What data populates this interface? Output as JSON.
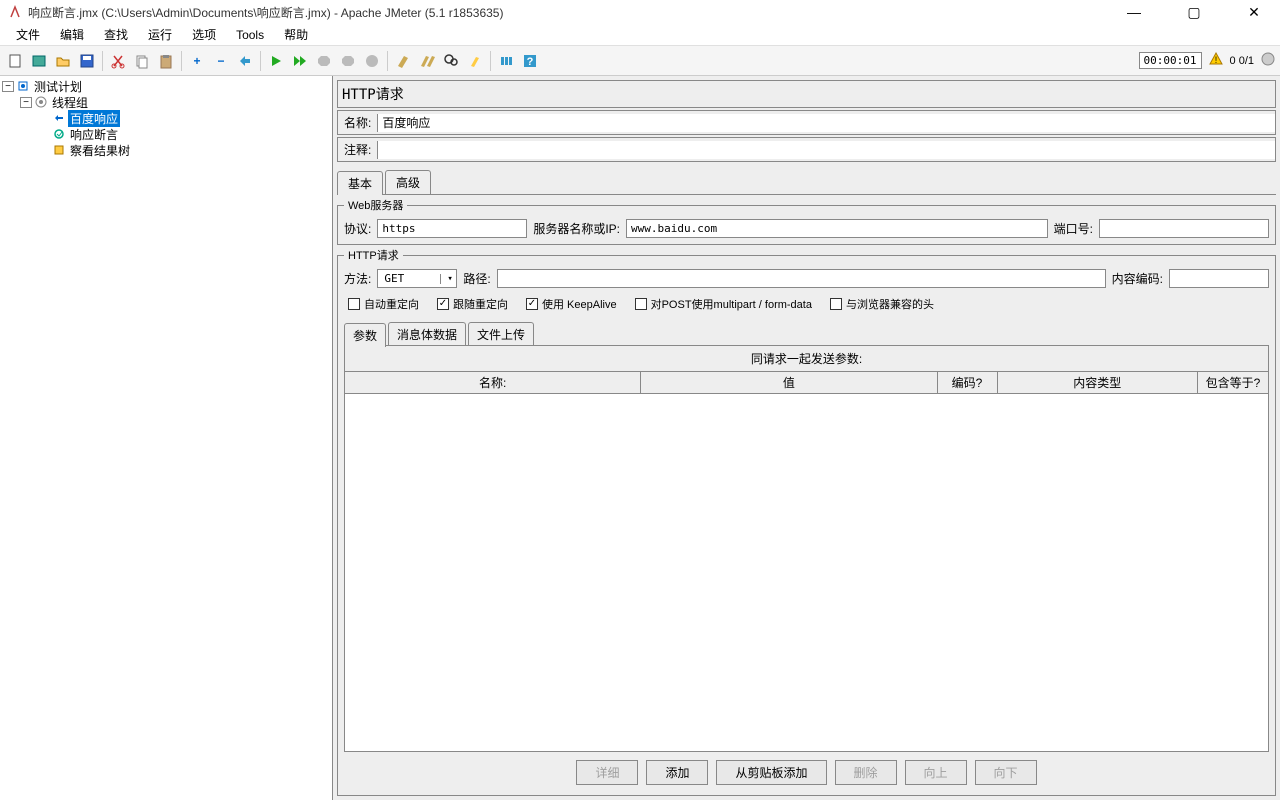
{
  "window": {
    "title": "响应断言.jmx (C:\\Users\\Admin\\Documents\\响应断言.jmx) - Apache JMeter (5.1 r1853635)"
  },
  "menu": {
    "file": "文件",
    "edit": "编辑",
    "search": "查找",
    "run": "运行",
    "options": "选项",
    "tools": "Tools",
    "help": "帮助"
  },
  "toolbar": {
    "timer": "00:00:01",
    "counter": "0  0/1"
  },
  "tree": {
    "root": "测试计划",
    "threadGroup": "线程组",
    "httpRequest": "百度响应",
    "assertion": "响应断言",
    "viewResults": "察看结果树"
  },
  "panel": {
    "title": "HTTP请求",
    "nameLabel": "名称:",
    "nameValue": "百度响应",
    "commentLabel": "注释:",
    "commentValue": ""
  },
  "tabs": {
    "basic": "基本",
    "advanced": "高级"
  },
  "webServer": {
    "legend": "Web服务器",
    "protocolLabel": "协议:",
    "protocolValue": "https",
    "serverLabel": "服务器名称或IP:",
    "serverValue": "www.baidu.com",
    "portLabel": "端口号:",
    "portValue": ""
  },
  "httpReq": {
    "legend": "HTTP请求",
    "methodLabel": "方法:",
    "methodValue": "GET",
    "pathLabel": "路径:",
    "pathValue": "",
    "encodingLabel": "内容编码:",
    "encodingValue": ""
  },
  "checkboxes": {
    "autoRedirect": "自动重定向",
    "followRedirect": "跟随重定向",
    "keepAlive": "使用 KeepAlive",
    "multipart": "对POST使用multipart / form-data",
    "browserCompat": "与浏览器兼容的头"
  },
  "subTabs": {
    "params": "参数",
    "body": "消息体数据",
    "upload": "文件上传"
  },
  "params": {
    "title": "同请求一起发送参数:",
    "colName": "名称:",
    "colValue": "值",
    "colEncode": "编码?",
    "colContentType": "内容类型",
    "colInclude": "包含等于?"
  },
  "buttons": {
    "detail": "详细",
    "add": "添加",
    "fromClipboard": "从剪贴板添加",
    "delete": "删除",
    "up": "向上",
    "down": "向下"
  }
}
